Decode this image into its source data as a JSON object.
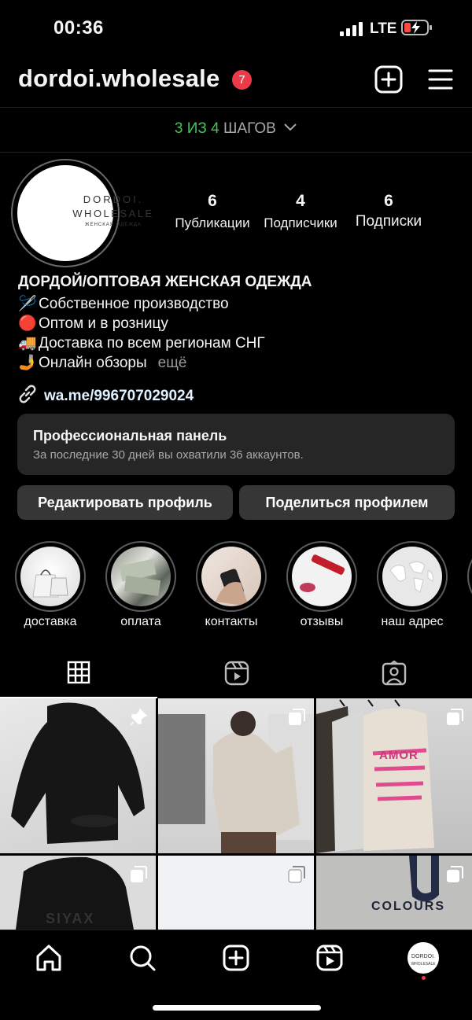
{
  "status_bar": {
    "time": "00:36",
    "network": "LTE"
  },
  "header": {
    "username": "dordoi.wholesale",
    "notification_count": "7"
  },
  "steps": {
    "done": "3 ИЗ 4",
    "rest": " ШАГОВ"
  },
  "avatar": {
    "line1": "DORDOI.",
    "line2": "WHOLESALE",
    "line3": "ЖЕНСКАЯ ОДЕЖДА"
  },
  "stats": [
    {
      "value": "6",
      "label": "Публикации"
    },
    {
      "value": "4",
      "label": "Подписчики"
    },
    {
      "value": "6",
      "label": "Подписки"
    }
  ],
  "bio": {
    "name": "ДОРДОЙ/ОПТОВАЯ ЖЕНСКАЯ ОДЕЖДА",
    "lines": [
      {
        "emoji": "🪡",
        "text": "Собственное производство"
      },
      {
        "emoji": "🔴",
        "text": "Оптом и в розницу"
      },
      {
        "emoji": "🚚",
        "text": "Доставка по всем регионам СНГ"
      },
      {
        "emoji": "🤳",
        "text": "Онлайн обзоры"
      }
    ],
    "more": "ещё",
    "link": "wa.me/996707029024"
  },
  "pro_panel": {
    "title": "Профессиональная панель",
    "subtitle": "За последние 30 дней вы охватили 36 аккаунтов."
  },
  "buttons": {
    "edit": "Редактировать профиль",
    "share": "Поделиться профилем"
  },
  "highlights": [
    {
      "label": "доставка"
    },
    {
      "label": "оплата"
    },
    {
      "label": "контакты"
    },
    {
      "label": "отзывы"
    },
    {
      "label": "наш адрес"
    }
  ],
  "tabs": [
    "grid-tab",
    "reels-tab",
    "tagged-tab"
  ],
  "posts": [
    {
      "icon": "pin-icon",
      "text": ""
    },
    {
      "icon": "carousel-icon",
      "text": ""
    },
    {
      "icon": "carousel-icon",
      "text": "AMOR"
    },
    {
      "icon": "carousel-icon",
      "text": "SIYAX"
    },
    {
      "icon": "carousel-icon",
      "text": ""
    },
    {
      "icon": "carousel-icon",
      "text": "COLOURS"
    }
  ],
  "colors": {
    "background": "#000000",
    "accent_green": "#45c35a",
    "notification_red": "#ed3a4a",
    "button_bg": "#363636"
  }
}
